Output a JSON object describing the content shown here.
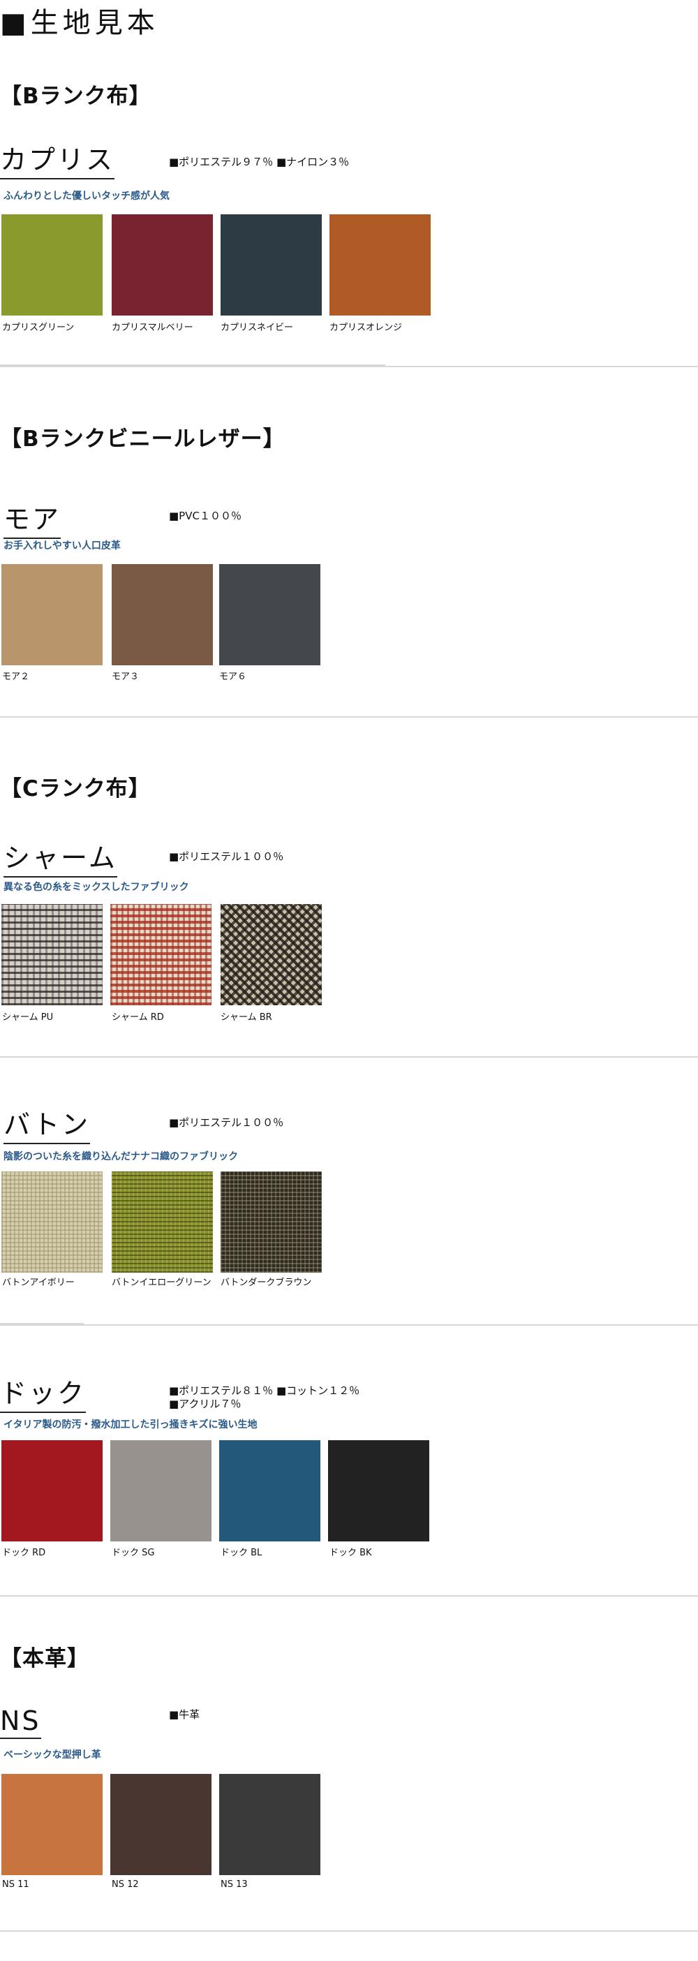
{
  "page_title": "■生地見本",
  "sections": {
    "b_cloth": {
      "heading": "【Bランク布】"
    },
    "b_vinyl": {
      "heading": "【Bランクビニールレザー】"
    },
    "c_cloth": {
      "heading": "【Cランク布】"
    },
    "leather": {
      "heading": "【本革】"
    }
  },
  "fabrics": {
    "capris": {
      "name": "カプリス",
      "composition": [
        "■ポリエステル９７％ ■ナイロン３％"
      ],
      "feature": "ふんわりとした優しいタッチ感が人気",
      "swatches": [
        {
          "label": "カプリスグリーン",
          "color": "#8a9a2c"
        },
        {
          "label": "カプリスマルベリー",
          "color": "#7a2330"
        },
        {
          "label": "カプリスネイビー",
          "color": "#2d3b45"
        },
        {
          "label": "カプリスオレンジ",
          "color": "#b05a26"
        }
      ]
    },
    "moa": {
      "name": "モア",
      "composition": [
        "■PVC１００％"
      ],
      "feature": "お手入れしやすい人口皮革",
      "swatches": [
        {
          "label": "モア２",
          "color": "#b8956a"
        },
        {
          "label": "モア３",
          "color": "#7a5a44"
        },
        {
          "label": "モア６",
          "color": "#44474b"
        }
      ]
    },
    "charme": {
      "name": "シャーム",
      "composition": [
        "■ポリエステル１００％"
      ],
      "feature": "異なる色の糸をミックスしたファブリック",
      "swatches": [
        {
          "label": "シャーム PU",
          "color": "#cfc8bc"
        },
        {
          "label": "シャーム RD",
          "color": "#c96a58"
        },
        {
          "label": "シャーム BR",
          "color": "#6a5c48"
        }
      ]
    },
    "baton": {
      "name": "バトン",
      "composition": [
        "■ポリエステル１００％"
      ],
      "feature": "陰影のついた糸を織り込んだナナコ織のファブリック",
      "swatches": [
        {
          "label": "バトンアイボリー",
          "color": "#d6cfae"
        },
        {
          "label": "バトンイエローグリーン",
          "color": "#8a8f30"
        },
        {
          "label": "バトンダークブラウン",
          "color": "#2e2a22"
        }
      ]
    },
    "dock": {
      "name": "ドック",
      "composition": [
        "■ポリエステル８１％ ■コットン１２％",
        "■アクリル７％"
      ],
      "feature": "イタリア製の防汚・撥水加工した引っ掻きキズに強い生地",
      "swatches": [
        {
          "label": "ドック RD",
          "color": "#a3181f"
        },
        {
          "label": "ドック SG",
          "color": "#97928d"
        },
        {
          "label": "ドック BL",
          "color": "#24587a"
        },
        {
          "label": "ドック BK",
          "color": "#222222"
        }
      ]
    },
    "ns": {
      "name": "NS",
      "composition": [
        "■牛革"
      ],
      "feature": "ベーシックな型押し革",
      "swatches": [
        {
          "label": "NS 11",
          "color": "#c8743e"
        },
        {
          "label": "NS 12",
          "color": "#4a3630"
        },
        {
          "label": "NS 13",
          "color": "#3a3a3a"
        }
      ]
    }
  }
}
